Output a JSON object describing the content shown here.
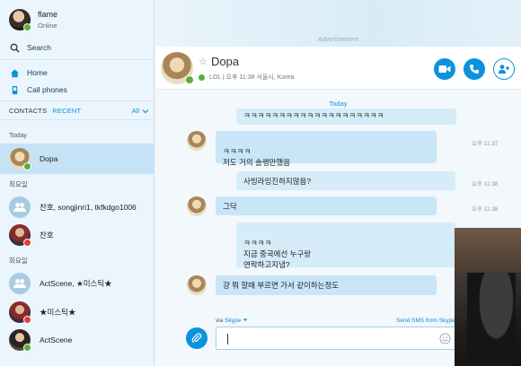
{
  "profile": {
    "name": "flame",
    "status": "Online"
  },
  "sidebar": {
    "search_label": "Search",
    "home_label": "Home",
    "call_phones_label": "Call phones",
    "tabs": {
      "contacts": "CONTACTS",
      "recent": "RECENT",
      "all": "All"
    }
  },
  "sections": {
    "today": "Today",
    "yesterday": "최요일",
    "older": "화요일"
  },
  "contacts": [
    {
      "name": "Dopa",
      "selected": true
    },
    {
      "name": "찬호, songjinri1, tkfkdgo1006"
    },
    {
      "name": "찬호"
    },
    {
      "name": "ActScene, ★미스틱★"
    },
    {
      "name": "★미스틱★"
    },
    {
      "name": "ActScene"
    }
  ],
  "ad": {
    "label": "Advertisement"
  },
  "chat": {
    "title": "Dopa",
    "subtitle": "LOL | 오후 11:38 서울시, Korea",
    "day_label": "Today",
    "messages": [
      {
        "text": "ㅋㅋㅋㅋㅋㅋㅋㅋㅋㅋㅋㅋㅋㅋㅋㅋㅋㅋㅋㅋ",
        "time": ""
      },
      {
        "text": "ㅋㅋㅋㅋ\n저도 거의 솔랭만했음",
        "time": "오후 11:37"
      },
      {
        "text": "사빙라잉진하지않음?",
        "time": "오후 11:38"
      },
      {
        "text": "그닥",
        "time": "오후 11:38"
      },
      {
        "text": "ㅋㅋㅋㅋ\n지금 중국에선 누구랑\n연락하고지냄?",
        "time": ""
      },
      {
        "text": "걍 뭐 할때 부르면 가서 같이하는정도",
        "time": ""
      }
    ]
  },
  "compose": {
    "via_prefix": "via",
    "via_service": "Skype",
    "sms_label": "Send SMS from Skype"
  },
  "colors": {
    "accent": "#0b92dc",
    "bubble": "#c8e6f8",
    "online": "#57b03c"
  }
}
